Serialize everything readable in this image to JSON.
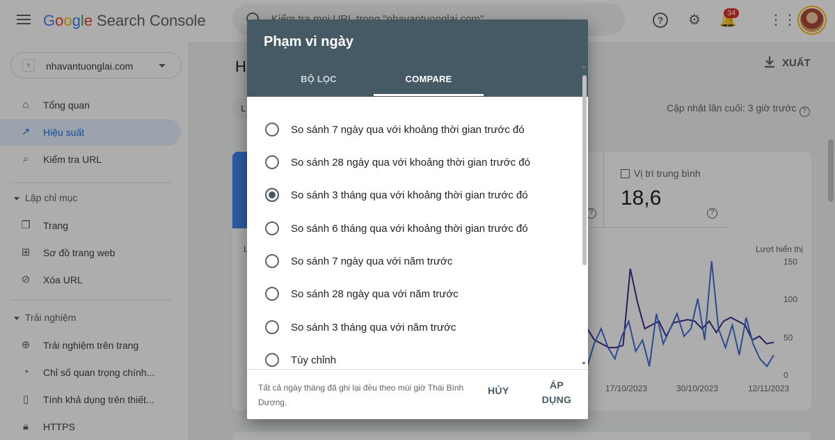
{
  "app": {
    "logo_google": [
      "G",
      "o",
      "o",
      "g",
      "l",
      "e"
    ],
    "logo_product": "Search Console",
    "search_placeholder": "Kiểm tra mọi URL trong \"nhavantuonglai.com\"",
    "notification_count": "34"
  },
  "sidebar": {
    "property": "nhavantuonglai.com",
    "property_favicon": "♆",
    "items_top": [
      {
        "label": "Tổng quan",
        "icon": "home-icon"
      },
      {
        "label": "Hiệu suất",
        "icon": "trending-up-icon"
      },
      {
        "label": "Kiểm tra URL",
        "icon": "search-icon"
      }
    ],
    "section_indexing": "Lập chỉ mục",
    "items_indexing": [
      {
        "label": "Trang",
        "icon": "pages-icon"
      },
      {
        "label": "Sơ đồ trang web",
        "icon": "sitemap-icon"
      },
      {
        "label": "Xóa URL",
        "icon": "visibility-off-icon"
      }
    ],
    "section_experience": "Trải nghiệm",
    "items_experience": [
      {
        "label": "Trải nghiệm trên trang",
        "icon": "plus-circle-icon"
      },
      {
        "label": "Chỉ số quan trọng chính...",
        "icon": "speed-icon"
      },
      {
        "label": "Tính khả dụng trên thiết...",
        "icon": "phone-icon"
      },
      {
        "label": "HTTPS",
        "icon": "lock-icon"
      }
    ]
  },
  "main": {
    "page_title_initial": "H",
    "export_label": "XUẤT",
    "filter_chip_initial": "L",
    "last_updated": "Cập nhật lần cuối: 3 giờ trước",
    "metric_label": "Vị trí trung bình",
    "metric_value": "18,6",
    "chart_left_label_initial": "L",
    "axis_title": "Lượt hiển thị",
    "y_ticks": [
      "150",
      "100",
      "50",
      "0"
    ],
    "x_ticks": [
      "17/10/2023",
      "30/10/2023",
      "12/11/2023"
    ]
  },
  "chart_data": {
    "type": "line",
    "ylabel": "Lượt hiển thị",
    "ylim": [
      0,
      150
    ],
    "x_ticks": [
      "17/10/2023",
      "30/10/2023",
      "12/11/2023"
    ],
    "series": [
      {
        "values": [
          60,
          45,
          40,
          35,
          35,
          38,
          140,
          95,
          60,
          65,
          70,
          50,
          68,
          70,
          72,
          70,
          60,
          70,
          55,
          70,
          75,
          70,
          65,
          45,
          50,
          40,
          42
        ],
        "color": "#3f2a8c"
      },
      {
        "values": [
          10,
          40,
          60,
          35,
          20,
          50,
          70,
          30,
          45,
          10,
          80,
          40,
          60,
          80,
          50,
          60,
          100,
          45,
          150,
          60,
          35,
          65,
          25,
          75,
          40,
          20,
          10,
          25
        ],
        "color": "#3d6fd9"
      }
    ]
  },
  "dialog": {
    "title": "Phạm vi ngày",
    "tabs": [
      "BỘ LỌC",
      "COMPARE"
    ],
    "options": [
      "So sánh 7 ngày qua với khoảng thời gian trước đó",
      "So sánh 28 ngày qua với khoảng thời gian trước đó",
      "So sánh 3 tháng qua với khoảng thời gian trước đó",
      "So sánh 6 tháng qua với khoảng thời gian trước đó",
      "So sánh 7 ngày qua với năm trước",
      "So sánh 28 ngày qua với năm trước",
      "So sánh 3 tháng qua với năm trước",
      "Tùy chỉnh"
    ],
    "selected_index": 2,
    "footnote": "Tất cả ngày tháng đã ghi lại đều theo múi giờ Thái Bình Dương.",
    "cancel": "HỦY",
    "apply": "ÁP DỤNG"
  }
}
